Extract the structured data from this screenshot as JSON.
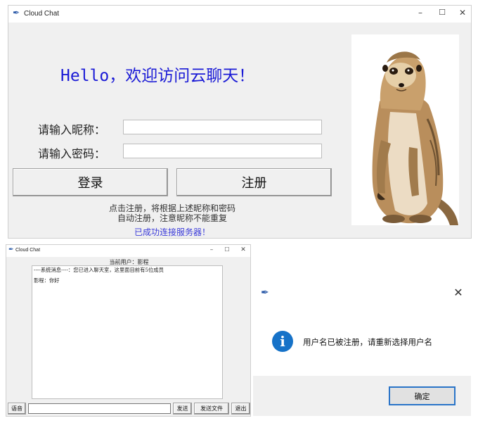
{
  "login_window": {
    "title": "Cloud Chat",
    "welcome": "Hello，欢迎访问云聊天！",
    "nickname_label": "请输入昵称：",
    "password_label": "请输入密码：",
    "nickname_value": "",
    "password_value": "",
    "login_button": "登录",
    "register_button": "注册",
    "hint_line1": "点击注册，将根据上述昵称和密码",
    "hint_line2": "自动注册，注意昵称不能重复",
    "status": "已成功连接服务器！",
    "image": "meerkat-photo"
  },
  "chat_window": {
    "title": "Cloud Chat",
    "current_user": "当前用户：影程",
    "messages": [
      "----系统消息----：您已进入聊天室，这里面目前有5位成员",
      "影程：你好"
    ],
    "voice_button": "语音",
    "input_value": "",
    "send_button": "发送",
    "send_file_button": "发送文件",
    "exit_button": "退出"
  },
  "dialog": {
    "message": "用户名已被注册，请重新选择用户名",
    "ok_button": "确定",
    "icon": "info-icon"
  },
  "colors": {
    "welcome": "#1a1ad6",
    "status": "#3b3bd9",
    "info_icon": "#1672c8",
    "ok_border": "#2a74c8"
  }
}
